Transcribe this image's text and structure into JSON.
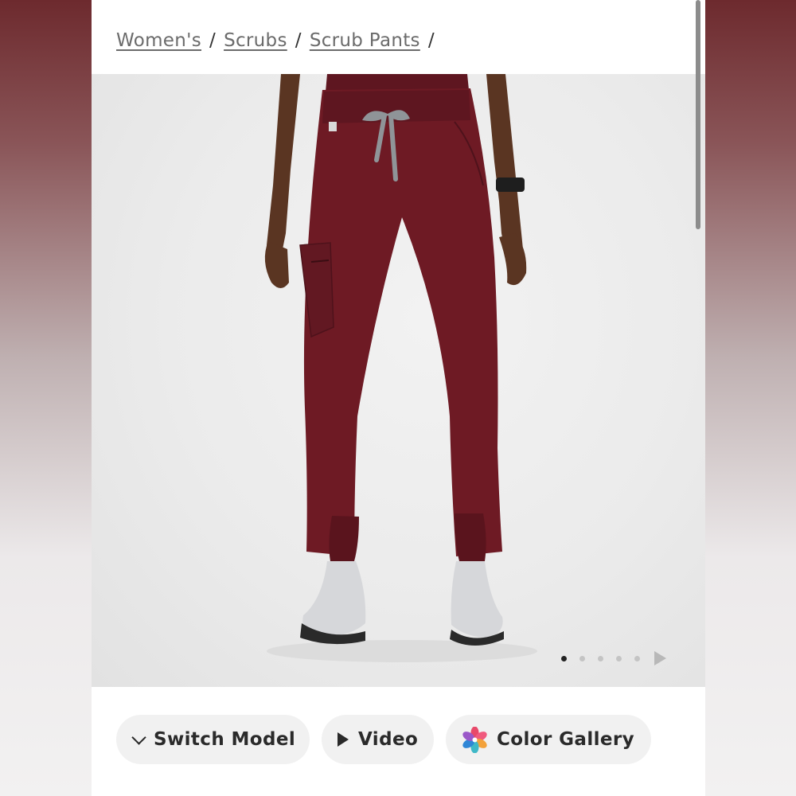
{
  "breadcrumb": {
    "items": [
      "Women's",
      "Scrubs",
      "Scrub Pants"
    ],
    "separator": "/"
  },
  "hero": {
    "product_color": "#6e1a24",
    "drawstring_color": "#8f9498",
    "carousel": {
      "slide_count": 5,
      "active_index": 1
    }
  },
  "actions": {
    "switch_model": {
      "label": "Switch Model",
      "icon": "chevron-down-icon"
    },
    "video": {
      "label": "Video",
      "icon": "play-icon"
    },
    "color_gallery": {
      "label": "Color Gallery",
      "icon": "color-palette-icon"
    }
  },
  "colors": {
    "page_background": "#ffffff",
    "hero_background": "#ebebeb",
    "pill_background": "#f1f1f1",
    "text_dark": "#2a2a2a",
    "breadcrumb_text": "#6b6b6b"
  }
}
